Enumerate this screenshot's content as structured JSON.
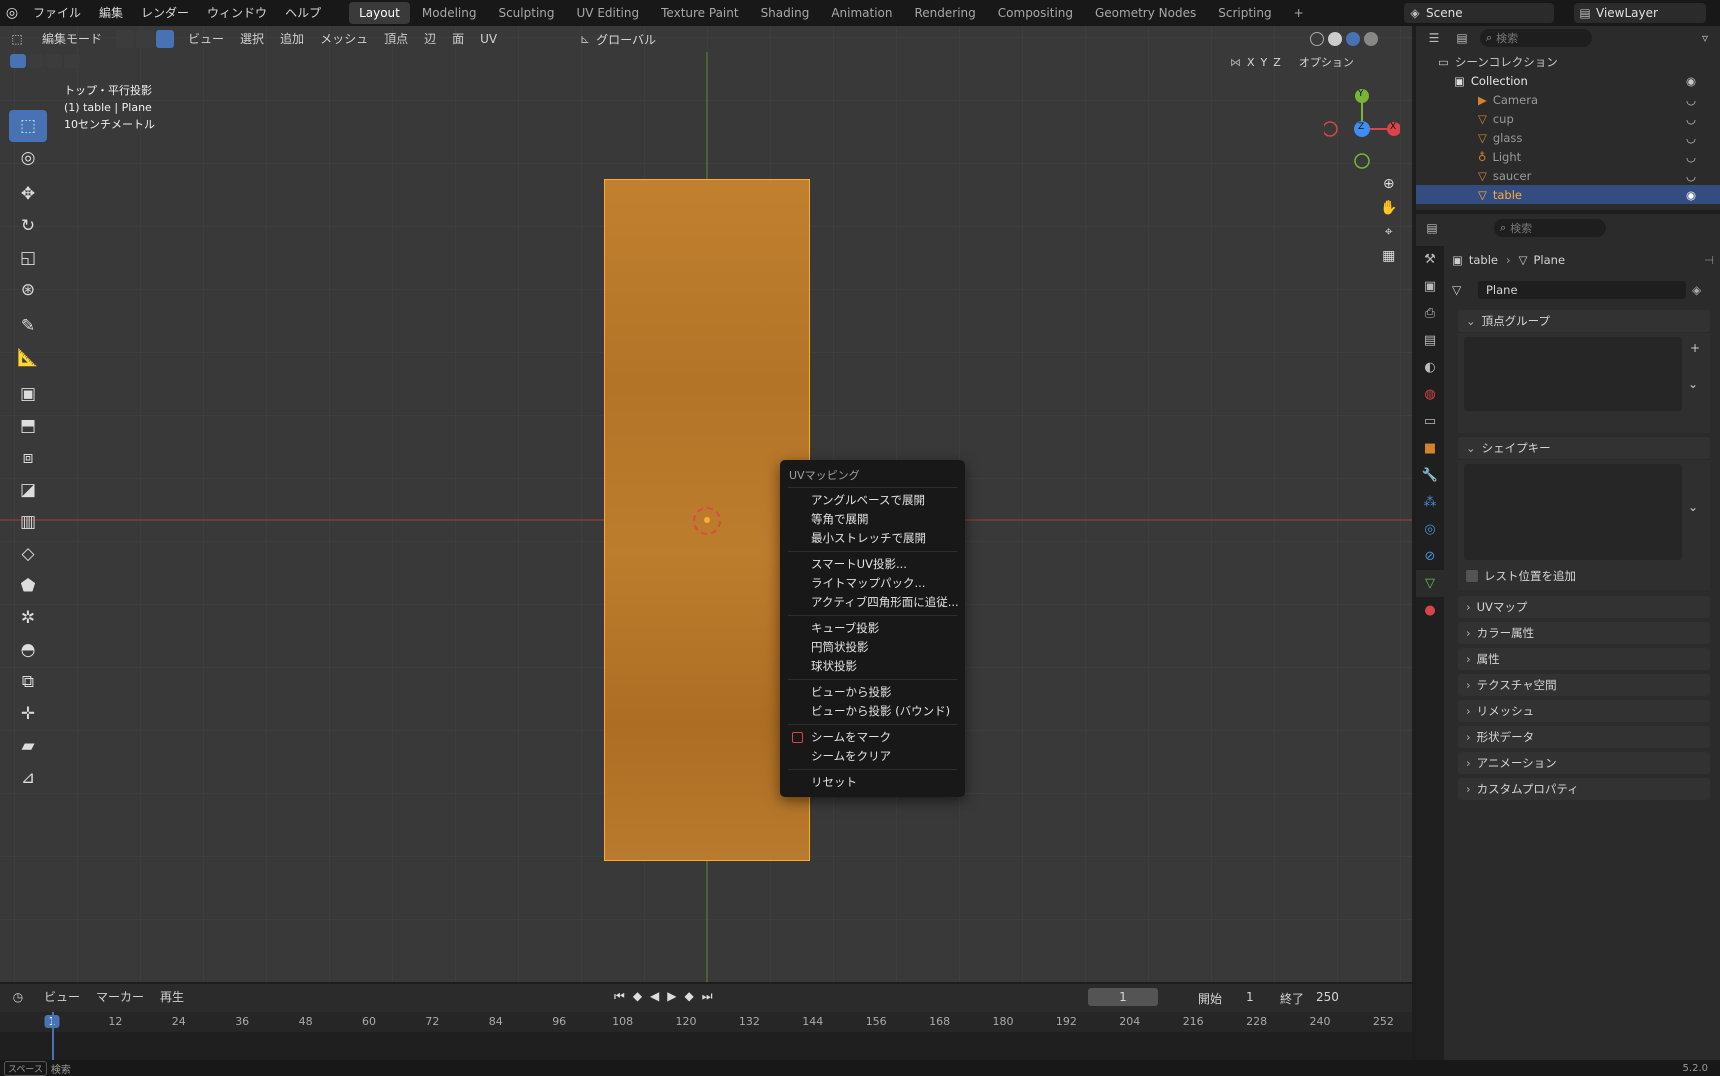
{
  "topbar": {
    "menus": [
      "ファイル",
      "編集",
      "レンダー",
      "ウィンドウ",
      "ヘルプ"
    ],
    "workspaces": [
      "Layout",
      "Modeling",
      "Sculpting",
      "UV Editing",
      "Texture Paint",
      "Shading",
      "Animation",
      "Rendering",
      "Compositing",
      "Geometry Nodes",
      "Scripting"
    ],
    "active_workspace": "Layout",
    "add_tab": "+",
    "scene": "Scene",
    "view_layer": "ViewLayer"
  },
  "viewport_header": {
    "mode": "編集モード",
    "menus": [
      "ビュー",
      "選択",
      "追加",
      "メッシュ",
      "頂点",
      "辺",
      "面",
      "UV"
    ],
    "orientation": "グローバル",
    "axis_x": "X",
    "axis_y": "Y",
    "axis_z": "Z",
    "options": "オプション"
  },
  "viewport_info": {
    "line1": "トップ・平行投影",
    "line2": "(1) table | Plane",
    "line3": "10センチメートル"
  },
  "gizmo": {
    "x": "X",
    "y": "Y",
    "z": "Z"
  },
  "context_menu": {
    "title": "UVマッピング",
    "groups": [
      [
        "アングルベースで展開",
        "等角で展開",
        "最小ストレッチで展開"
      ],
      [
        "スマートUV投影...",
        "ライトマップパック...",
        "アクティブ四角形面に追従..."
      ],
      [
        "キューブ投影",
        "円筒状投影",
        "球状投影"
      ],
      [
        "ビューから投影",
        "ビューから投影 (バウンド)"
      ],
      [
        "シームをマーク",
        "シームをクリア"
      ],
      [
        "リセット"
      ]
    ]
  },
  "outliner": {
    "search_placeholder": "検索",
    "scene_collection": "シーンコレクション",
    "collection": "Collection",
    "items": [
      "Camera",
      "cup",
      "glass",
      "Light",
      "saucer",
      "table"
    ],
    "selected": "table"
  },
  "properties": {
    "search_placeholder": "検索",
    "breadcrumb_object": "table",
    "breadcrumb_data": "Plane",
    "mesh_name": "Plane",
    "panels_open": [
      "頂点グループ",
      "シェイプキー"
    ],
    "rest_position": "レスト位置を追加",
    "panels_closed": [
      "UVマップ",
      "カラー属性",
      "属性",
      "テクスチャ空間",
      "リメッシュ",
      "形状データ",
      "アニメーション",
      "カスタムプロパティ"
    ]
  },
  "timeline": {
    "menus": [
      "ビュー",
      "マーカー",
      "再生"
    ],
    "current_frame": "1",
    "start_label": "開始",
    "start": "1",
    "end_label": "終了",
    "end": "250",
    "ticks": [
      "1",
      "12",
      "24",
      "36",
      "48",
      "60",
      "72",
      "84",
      "96",
      "108",
      "120",
      "132",
      "144",
      "156",
      "168",
      "180",
      "192",
      "204",
      "216",
      "228",
      "240",
      "252"
    ]
  },
  "statusbar": {
    "hint_key": "スペース",
    "hint": "検索",
    "version": "5.2.0"
  },
  "colors": {
    "accent": "#4772b3",
    "plane": "#b8772a",
    "selected_outline": "#ffaa33",
    "x_axis": "#d9434a",
    "y_axis": "#79b43a",
    "z_axis": "#3d8ef0"
  }
}
